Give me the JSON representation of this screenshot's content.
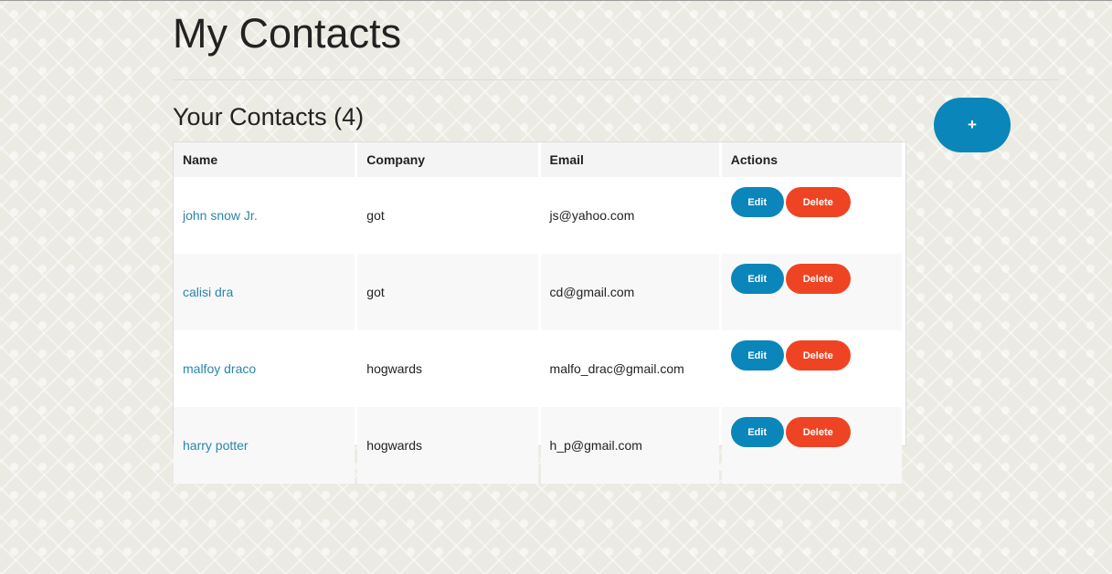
{
  "header": {
    "title": "My Contacts"
  },
  "section": {
    "title": "Your Contacts (4)",
    "add_label": "+"
  },
  "table": {
    "columns": [
      "Name",
      "Company",
      "Email",
      "Actions"
    ],
    "rows": [
      {
        "name": "john snow Jr.",
        "company": "got",
        "email": "js@yahoo.com"
      },
      {
        "name": "calisi dra",
        "company": "got",
        "email": "cd@gmail.com"
      },
      {
        "name": "malfoy draco",
        "company": "hogwards",
        "email": "malfo_drac@gmail.com"
      },
      {
        "name": "harry potter",
        "company": "hogwards",
        "email": "h_p@gmail.com"
      }
    ],
    "edit_label": "Edit",
    "delete_label": "Delete"
  },
  "colors": {
    "link": "#2a86a8",
    "edit_button": "#0a86bb",
    "delete_button": "#ef4423",
    "add_button": "#0a86bb"
  }
}
